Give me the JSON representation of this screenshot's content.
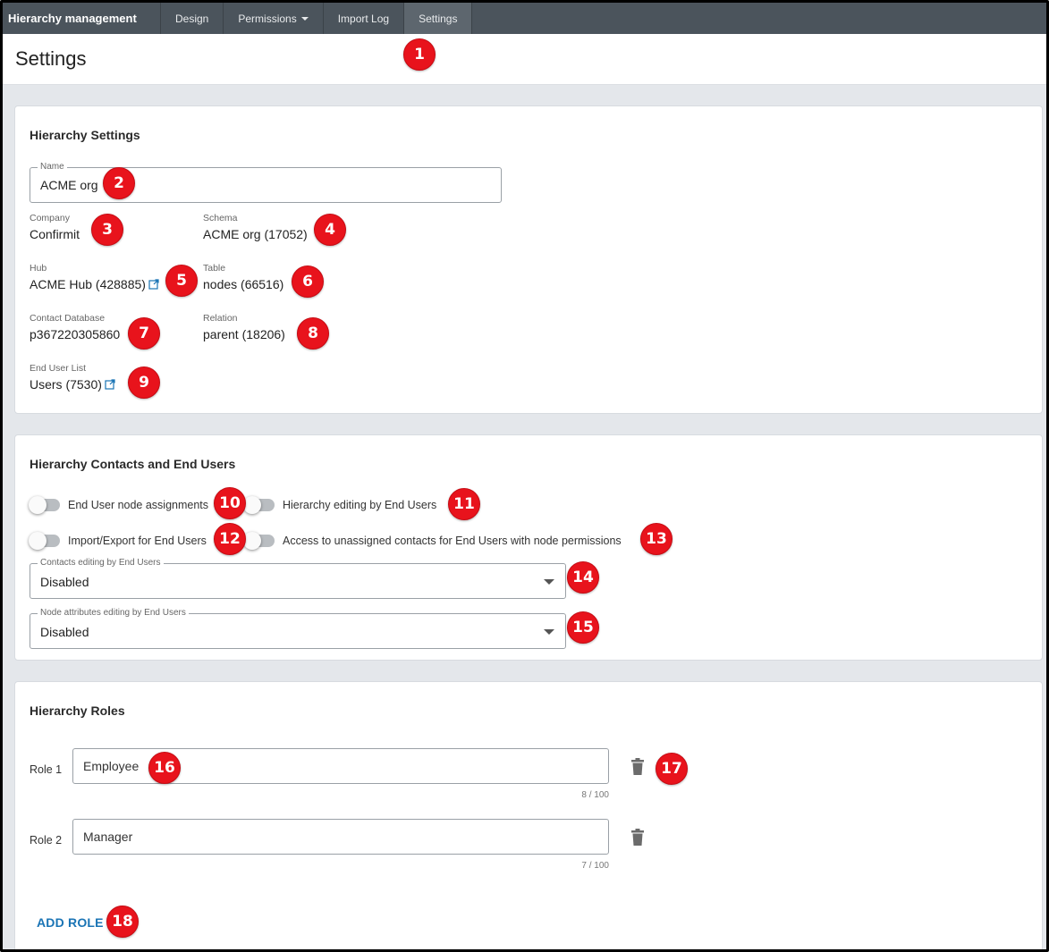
{
  "nav": {
    "brand": "Hierarchy management",
    "tabs": [
      {
        "label": "Design"
      },
      {
        "label": "Permissions"
      },
      {
        "label": "Import Log"
      },
      {
        "label": "Settings"
      }
    ]
  },
  "page": {
    "title": "Settings"
  },
  "hierarchy_settings": {
    "title": "Hierarchy Settings",
    "name_label": "Name",
    "name_value": "ACME org",
    "company_label": "Company",
    "company_value": "Confirmit",
    "schema_label": "Schema",
    "schema_value": "ACME org (17052)",
    "hub_label": "Hub",
    "hub_value": "ACME Hub (428885)",
    "table_label": "Table",
    "table_value": "nodes (66516)",
    "contact_db_label": "Contact Database",
    "contact_db_value": "p367220305860",
    "relation_label": "Relation",
    "relation_value": "parent (18206)",
    "end_user_list_label": "End User List",
    "end_user_list_value": "Users (7530)"
  },
  "contacts": {
    "title": "Hierarchy Contacts and End Users",
    "toggles": [
      {
        "label": "End User node assignments"
      },
      {
        "label": "Hierarchy editing by End Users"
      },
      {
        "label": "Import/Export for End Users"
      },
      {
        "label": "Access to unassigned contacts for End Users with node permissions"
      }
    ],
    "contacts_editing_label": "Contacts editing by End Users",
    "contacts_editing_value": "Disabled",
    "node_attr_label": "Node attributes editing by End Users",
    "node_attr_value": "Disabled"
  },
  "roles": {
    "title": "Hierarchy Roles",
    "items": [
      {
        "label": "Role 1",
        "value": "Employee",
        "counter": "8 / 100"
      },
      {
        "label": "Role 2",
        "value": "Manager",
        "counter": "7 / 100"
      }
    ],
    "add_label": "ADD ROLE"
  },
  "badges": [
    "1",
    "2",
    "3",
    "4",
    "5",
    "6",
    "7",
    "8",
    "9",
    "10",
    "11",
    "12",
    "13",
    "14",
    "15",
    "16",
    "17",
    "18"
  ],
  "colors": {
    "badge": "#e8131c",
    "nav_bg": "#4b545c",
    "link": "#1a74b5"
  }
}
